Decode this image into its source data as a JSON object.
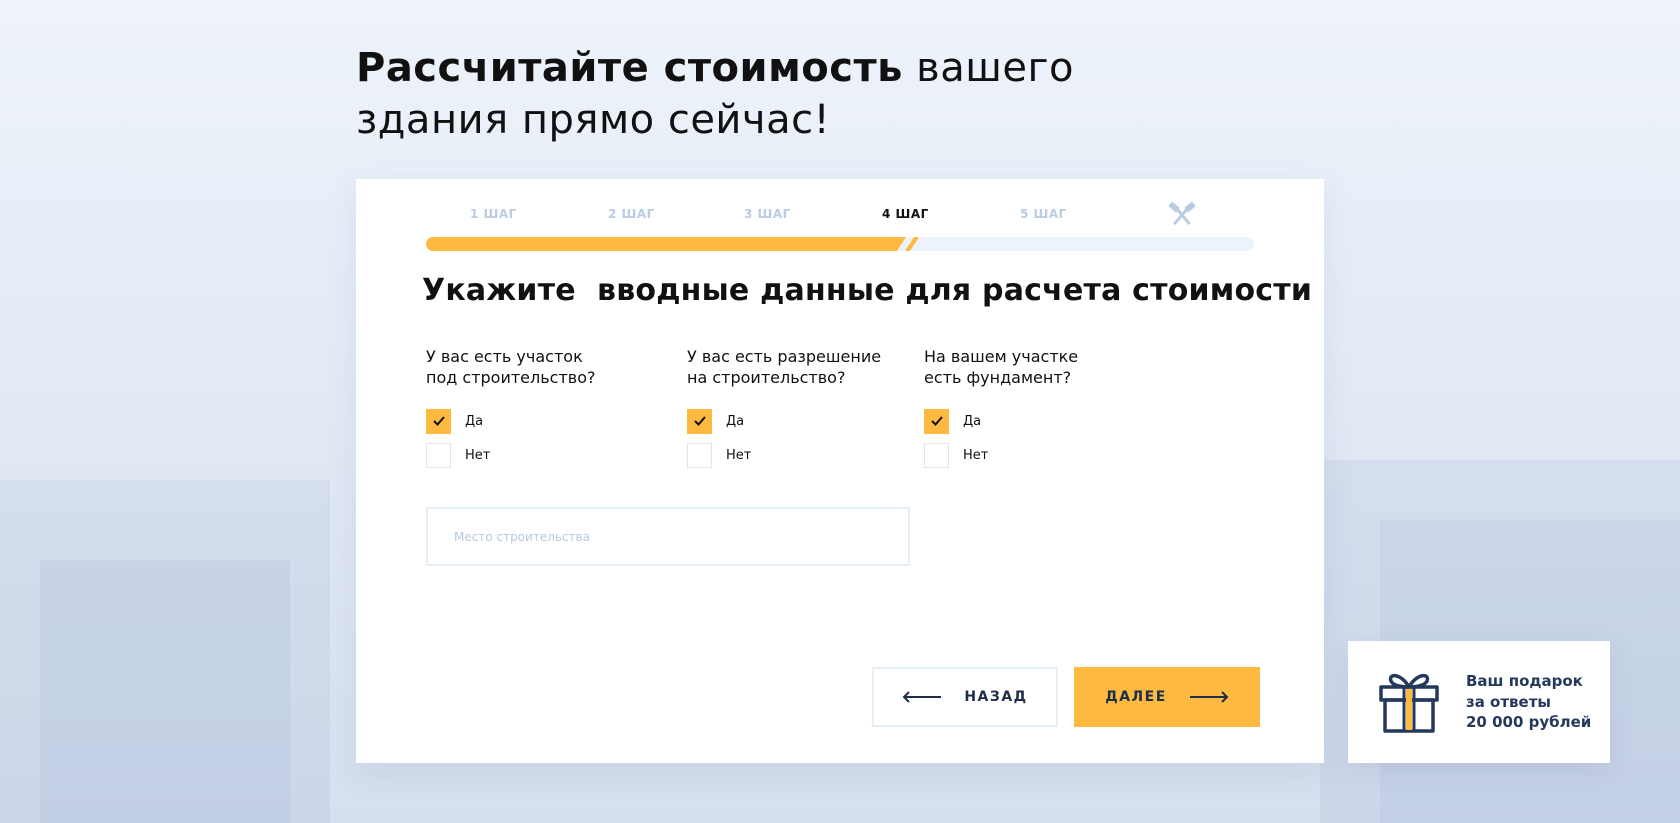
{
  "headline": {
    "bold": "Рассчитайте стоимость",
    "regular_1": " вашего",
    "regular_2": "здания прямо сейчас!"
  },
  "steps": {
    "items": [
      "1 ШАГ",
      "2 ШАГ",
      "3 ШАГ",
      "4 ШАГ",
      "5 ШАГ"
    ],
    "active_index": 3,
    "final_icon": "crossed-hammers-icon",
    "progress_percent": 58
  },
  "form": {
    "title": "Укажите  вводные данные для расчета стоимости",
    "questions": [
      {
        "label": "У вас есть участок\nпод строительство?",
        "options": [
          {
            "label": "Да",
            "checked": true
          },
          {
            "label": "Нет",
            "checked": false
          }
        ]
      },
      {
        "label": "У вас есть разрешение\nна строительство?",
        "options": [
          {
            "label": "Да",
            "checked": true
          },
          {
            "label": "Нет",
            "checked": false
          }
        ]
      },
      {
        "label": "На вашем участке\nесть фундамент?",
        "options": [
          {
            "label": "Да",
            "checked": true
          },
          {
            "label": "Нет",
            "checked": false
          }
        ]
      }
    ],
    "place": {
      "placeholder": "Место строительства",
      "value": ""
    }
  },
  "buttons": {
    "back": "НАЗАД",
    "next": "ДАЛЕЕ"
  },
  "gift": {
    "text": "Ваш подарок\nза ответы\n20 000 рублей",
    "icon": "gift-icon"
  },
  "colors": {
    "accent": "#fdb940",
    "navy": "#24395b",
    "track": "#ecf3fb",
    "muted": "#b9cce3"
  }
}
